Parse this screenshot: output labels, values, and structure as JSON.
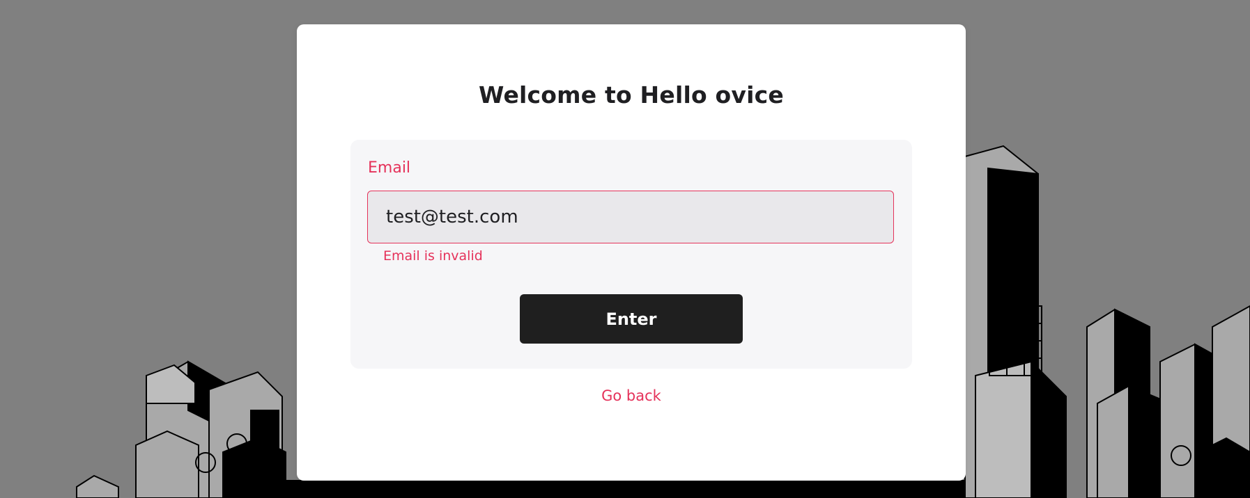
{
  "dialog": {
    "title": "Welcome to Hello ovice",
    "email": {
      "label": "Email",
      "value": "test@test.com",
      "error": "Email is invalid"
    },
    "enter_label": "Enter",
    "go_back_label": "Go back"
  },
  "colors": {
    "accent": "#e5325a",
    "button": "#1f1f1f",
    "overlay": "#808080",
    "card": "#f6f6f8"
  }
}
